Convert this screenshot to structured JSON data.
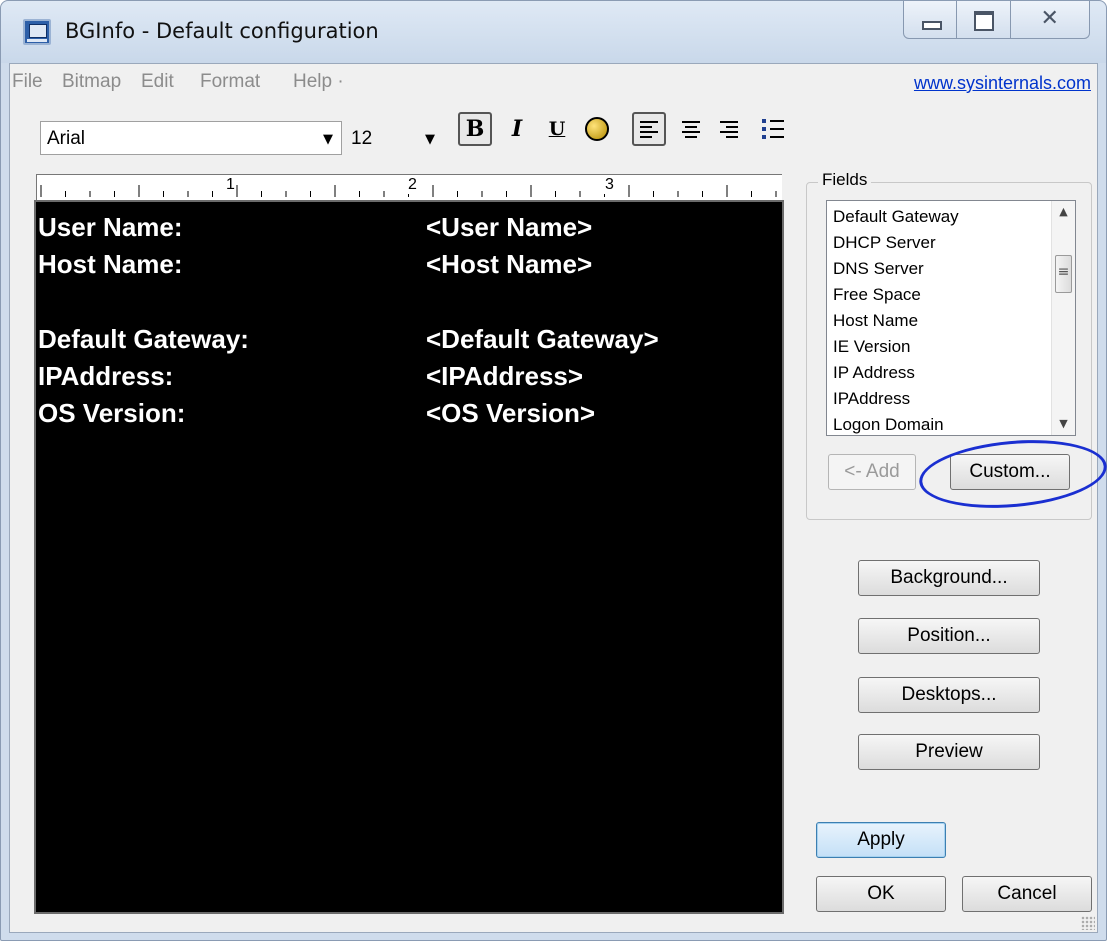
{
  "window": {
    "title": "BGInfo - Default configuration",
    "close_glyph": "☒"
  },
  "menu": {
    "items": [
      "File",
      "Bitmap",
      "Edit",
      "Format",
      "Help ·"
    ],
    "link": "www.sysinternals.com"
  },
  "toolbar": {
    "font": "Arial",
    "size": "12",
    "bold_label": "B",
    "italic_label": "I",
    "underline_label": "U",
    "icons": [
      "bold-icon",
      "italic-icon",
      "underline-icon",
      "color-icon",
      "align-left-icon",
      "align-center-icon",
      "align-right-icon",
      "bullet-list-icon"
    ]
  },
  "ruler": {
    "marks": [
      "1",
      "2",
      "3"
    ]
  },
  "editor": {
    "background": "#000000",
    "text_color": "#ffffff",
    "rows": [
      {
        "label": "User Name:",
        "value": "<User Name>"
      },
      {
        "label": "Host Name:",
        "value": "<Host Name>"
      },
      {
        "label": "Default Gateway:",
        "value": "<Default Gateway>"
      },
      {
        "label": "IPAddress:",
        "value": "<IPAddress>"
      },
      {
        "label": "OS Version:",
        "value": "<OS Version>"
      }
    ]
  },
  "fields": {
    "legend": "Fields",
    "items": [
      "Default Gateway",
      "DHCP Server",
      "DNS Server",
      "Free Space",
      "Host Name",
      "IE Version",
      "IP Address",
      "IPAddress",
      "Logon Domain"
    ],
    "add_label": "<- Add",
    "custom_label": "Custom..."
  },
  "buttons": {
    "background": "Background...",
    "position": "Position...",
    "desktops": "Desktops...",
    "preview": "Preview",
    "apply": "Apply",
    "ok": "OK",
    "cancel": "Cancel"
  },
  "colors": {
    "annotation_ellipse": "#1a2fd1",
    "link": "#0033cc"
  }
}
